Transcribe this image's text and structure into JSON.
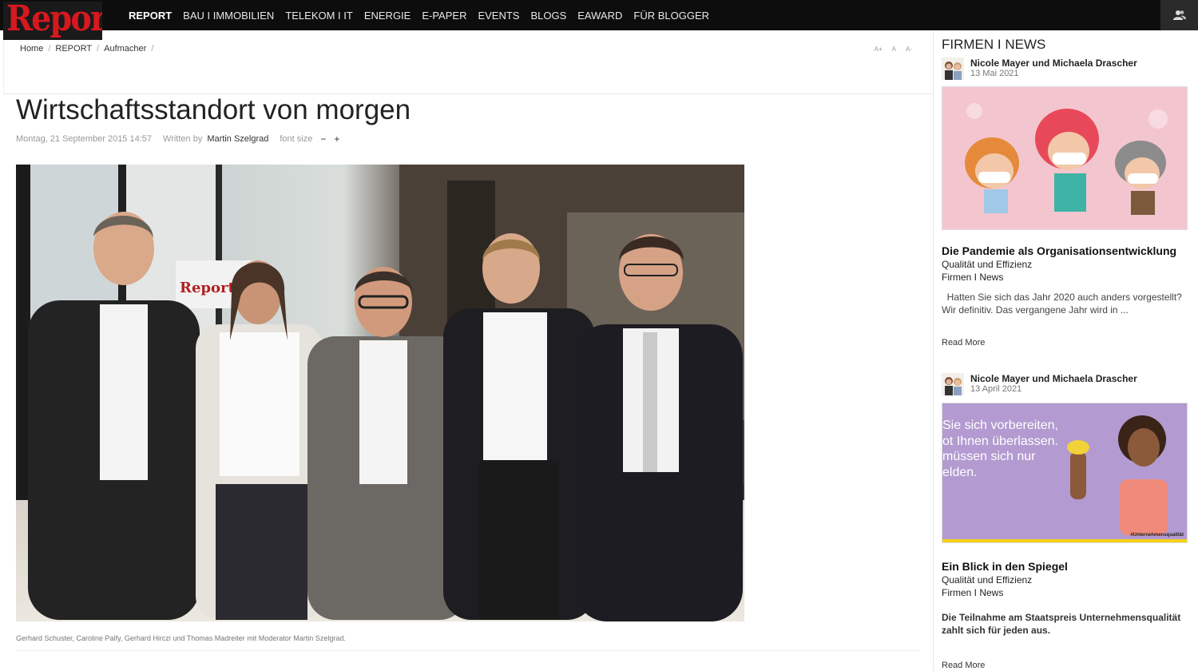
{
  "brand": {
    "logo_text": "Report",
    "logo_color": "#d6191f"
  },
  "nav": {
    "items": [
      {
        "label": "REPORT"
      },
      {
        "label": "BAU I IMMOBILIEN"
      },
      {
        "label": "TELEKOM I IT"
      },
      {
        "label": "ENERGIE"
      },
      {
        "label": "E-PAPER"
      },
      {
        "label": "EVENTS"
      },
      {
        "label": "BLOGS"
      },
      {
        "label": "EAWARD"
      },
      {
        "label": "FÜR BLOGGER"
      }
    ],
    "user_icon": "user-group-icon"
  },
  "breadcrumb": {
    "home": "Home",
    "section": "REPORT",
    "current": "Aufmacher",
    "sep": "/"
  },
  "font_controls": {
    "increase": "A+",
    "reset": "A",
    "decrease": "A-"
  },
  "article": {
    "title": "Wirtschaftsstandort von morgen",
    "date": "Montag, 21 September 2015 14:57",
    "written_by_label": "Written by",
    "author": "Martin Szelgrad",
    "font_size_label": "font size",
    "font_minus": "−",
    "font_plus": "+",
    "caption": "Gerhard Schuster, Caroline Palfy, Gerhard Hirczi und Thomas Madreiter mit Moderator Martin Szelgrad."
  },
  "sidebar": {
    "title": "FIRMEN I NEWS",
    "posts": [
      {
        "author": "Nicole Mayer und Michaela Drascher",
        "date": "13 Mai 2021",
        "headline": "Die Pandemie als Organisationsentwicklung",
        "tag1": "Qualität und Effizienz",
        "tag2": "Firmen I News",
        "excerpt": "  Hatten Sie sich das Jahr 2020 auch anders vorgestellt? Wir definitiv. Das vergangene Jahr wird in ...",
        "read_more": "Read More"
      },
      {
        "author": "Nicole Mayer und Michaela Drascher",
        "date": "13 April 2021",
        "headline": "Ein Blick in den Spiegel",
        "tag1": "Qualität und Effizienz",
        "tag2": "Firmen I News",
        "excerpt": "Die Teilnahme am Staatspreis Unternehmensqualität zahlt sich für jeden aus.",
        "read_more": "Read More",
        "banner_lines": [
          "Sie sich vorbereiten,",
          "ot Ihnen überlassen.",
          "müssen sich nur",
          "elden."
        ],
        "banner_tag": "#Unternehmensqualität"
      }
    ]
  }
}
